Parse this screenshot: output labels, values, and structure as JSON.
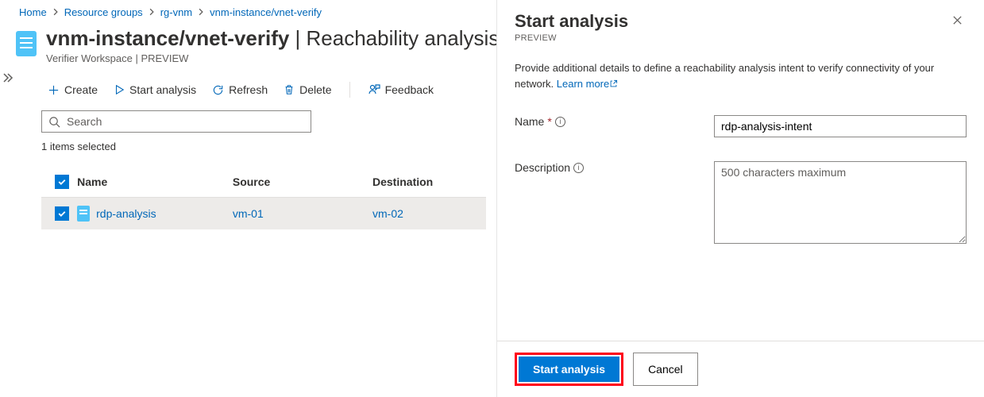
{
  "breadcrumb": {
    "home": "Home",
    "rg": "Resource groups",
    "rgname": "rg-vnm",
    "resource": "vnm-instance/vnet-verify"
  },
  "header": {
    "title_main": "vnm-instance/vnet-verify",
    "title_suffix": " | Reachability analysis",
    "subtitle": "Verifier Workspace | PREVIEW"
  },
  "toolbar": {
    "create": "Create",
    "start": "Start analysis",
    "refresh": "Refresh",
    "delete": "Delete",
    "feedback": "Feedback"
  },
  "search": {
    "placeholder": "Search"
  },
  "list": {
    "selected_text": "1 items selected",
    "columns": {
      "name": "Name",
      "source": "Source",
      "destination": "Destination"
    },
    "row": {
      "name": "rdp-analysis",
      "source": "vm-01",
      "destination": "vm-02"
    }
  },
  "panel": {
    "title": "Start analysis",
    "subtitle": "PREVIEW",
    "description": "Provide additional details to define a reachability analysis intent to verify connectivity of your network. ",
    "learn_more": "Learn more",
    "name_label": "Name",
    "name_value": "rdp-analysis-intent",
    "desc_label": "Description",
    "desc_placeholder": "500 characters maximum",
    "start_button": "Start analysis",
    "cancel_button": "Cancel"
  }
}
